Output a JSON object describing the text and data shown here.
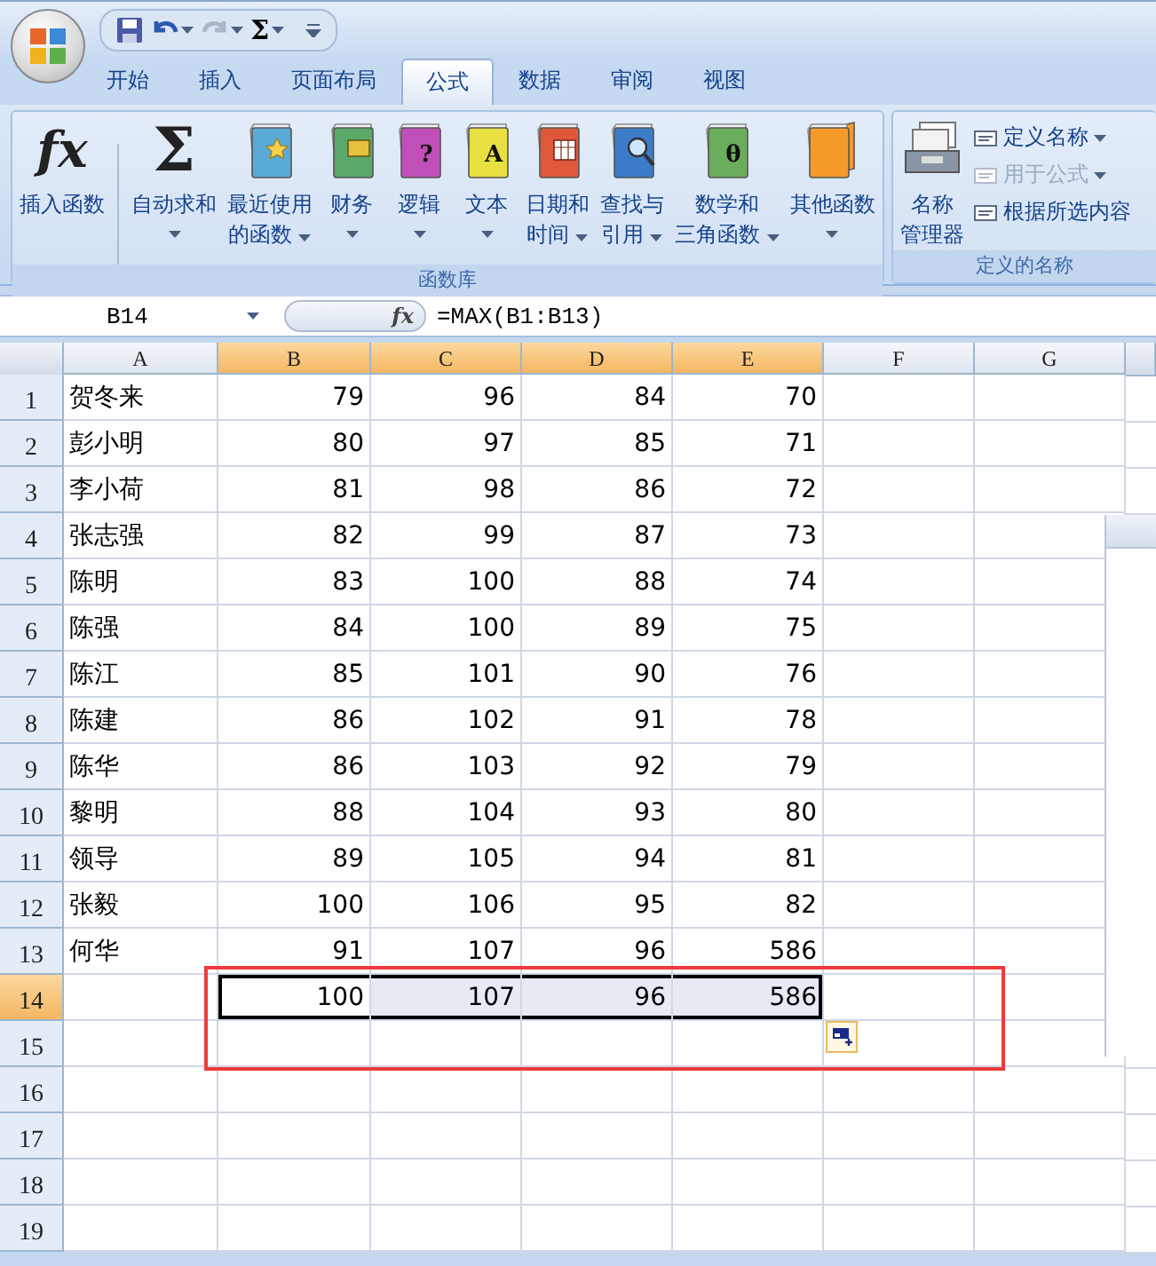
{
  "quick_access": [
    {
      "kind": "save"
    },
    {
      "kind": "undo"
    },
    {
      "kind": "redo"
    },
    {
      "kind": "sum",
      "glyph": "Σ"
    },
    {
      "kind": "customize"
    }
  ],
  "tabs": [
    {
      "label": "开始",
      "selected": false
    },
    {
      "label": "插入",
      "selected": false
    },
    {
      "label": "页面布局",
      "selected": false
    },
    {
      "label": "公式",
      "selected": true
    },
    {
      "label": "数据",
      "selected": false
    },
    {
      "label": "审阅",
      "selected": false
    },
    {
      "label": "视图",
      "selected": false
    }
  ],
  "ribbon": {
    "groups": [
      {
        "label": "函数库",
        "buttons": [
          {
            "kind": "glyph",
            "glyph": "fx",
            "lines": [
              "插入函数"
            ],
            "dropdown": false
          },
          {
            "kind": "separator"
          },
          {
            "kind": "glyph",
            "glyph": "Σ",
            "lines": [
              "自动求和"
            ],
            "dropdown": true
          },
          {
            "kind": "book",
            "color": "#5aaad8",
            "lines": [
              "最近使用",
              "的函数"
            ],
            "dropdown": true
          },
          {
            "kind": "book",
            "color": "#5aa86a",
            "lines": [
              "财务"
            ],
            "dropdown": true
          },
          {
            "kind": "book",
            "color": "#c050b8",
            "glyph": "?",
            "lines": [
              "逻辑"
            ],
            "dropdown": true
          },
          {
            "kind": "book",
            "color": "#e8e040",
            "glyph": "A",
            "lines": [
              "文本"
            ],
            "dropdown": true
          },
          {
            "kind": "book",
            "color": "#e0583a",
            "lines": [
              "日期和",
              "时间"
            ],
            "dropdown": true
          },
          {
            "kind": "book",
            "color": "#3a7cc8",
            "lines": [
              "查找与",
              "引用"
            ],
            "dropdown": true
          },
          {
            "kind": "book",
            "color": "#6aae5c",
            "glyph": "θ",
            "lines": [
              "数学和",
              "三角函数"
            ],
            "dropdown": true
          },
          {
            "kind": "books",
            "color": "#f59a2a",
            "lines": [
              "其他函数"
            ],
            "dropdown": true
          }
        ]
      },
      {
        "label": "定义的名称",
        "buttons": [
          {
            "kind": "manager",
            "lines": [
              "名称",
              "管理器"
            ],
            "dropdown": false
          },
          {
            "kind": "small",
            "label": "定义名称",
            "dropdown": true,
            "disabled": false
          },
          {
            "kind": "small",
            "label": "用于公式",
            "dropdown": true,
            "disabled": true
          },
          {
            "kind": "small",
            "label": "根据所选内容",
            "dropdown": false,
            "disabled": false
          }
        ]
      }
    ]
  },
  "formula_bar": {
    "name_box": "B14",
    "function_label": "fx",
    "formula": "=MAX(B1:B13)"
  },
  "sheet": {
    "columns": [
      {
        "label": "A",
        "selected": false
      },
      {
        "label": "B",
        "selected": true
      },
      {
        "label": "C",
        "selected": true
      },
      {
        "label": "D",
        "selected": true
      },
      {
        "label": "E",
        "selected": true
      },
      {
        "label": "F",
        "selected": false
      },
      {
        "label": "G",
        "selected": false
      }
    ],
    "rows": [
      {
        "number": "1",
        "selected": false,
        "name": "贺冬来",
        "values": [
          "79",
          "96",
          "84",
          "70"
        ]
      },
      {
        "number": "2",
        "selected": false,
        "name": "彭小明",
        "values": [
          "80",
          "97",
          "85",
          "71"
        ]
      },
      {
        "number": "3",
        "selected": false,
        "name": "李小荷",
        "values": [
          "81",
          "98",
          "86",
          "72"
        ]
      },
      {
        "number": "4",
        "selected": false,
        "name": "张志强",
        "values": [
          "82",
          "99",
          "87",
          "73"
        ]
      },
      {
        "number": "5",
        "selected": false,
        "name": "陈明",
        "values": [
          "83",
          "100",
          "88",
          "74"
        ]
      },
      {
        "number": "6",
        "selected": false,
        "name": "陈强",
        "values": [
          "84",
          "100",
          "89",
          "75"
        ]
      },
      {
        "number": "7",
        "selected": false,
        "name": "陈江",
        "values": [
          "85",
          "101",
          "90",
          "76"
        ]
      },
      {
        "number": "8",
        "selected": false,
        "name": "陈建",
        "values": [
          "86",
          "102",
          "91",
          "78"
        ]
      },
      {
        "number": "9",
        "selected": false,
        "name": "陈华",
        "values": [
          "86",
          "103",
          "92",
          "79"
        ]
      },
      {
        "number": "10",
        "selected": false,
        "name": "黎明",
        "values": [
          "88",
          "104",
          "93",
          "80"
        ]
      },
      {
        "number": "11",
        "selected": false,
        "name": "领导",
        "values": [
          "89",
          "105",
          "94",
          "81"
        ]
      },
      {
        "number": "12",
        "selected": false,
        "name": "张毅",
        "values": [
          "100",
          "106",
          "95",
          "82"
        ]
      },
      {
        "number": "13",
        "selected": false,
        "name": "何华",
        "values": [
          "91",
          "107",
          "96",
          "586"
        ]
      },
      {
        "number": "14",
        "selected": true,
        "values": [
          "100",
          "107",
          "96",
          "586"
        ]
      },
      {
        "number": "15",
        "selected": false
      },
      {
        "number": "16",
        "selected": false
      },
      {
        "number": "17",
        "selected": false
      },
      {
        "number": "18",
        "selected": false
      },
      {
        "number": "19",
        "selected": false
      }
    ]
  }
}
